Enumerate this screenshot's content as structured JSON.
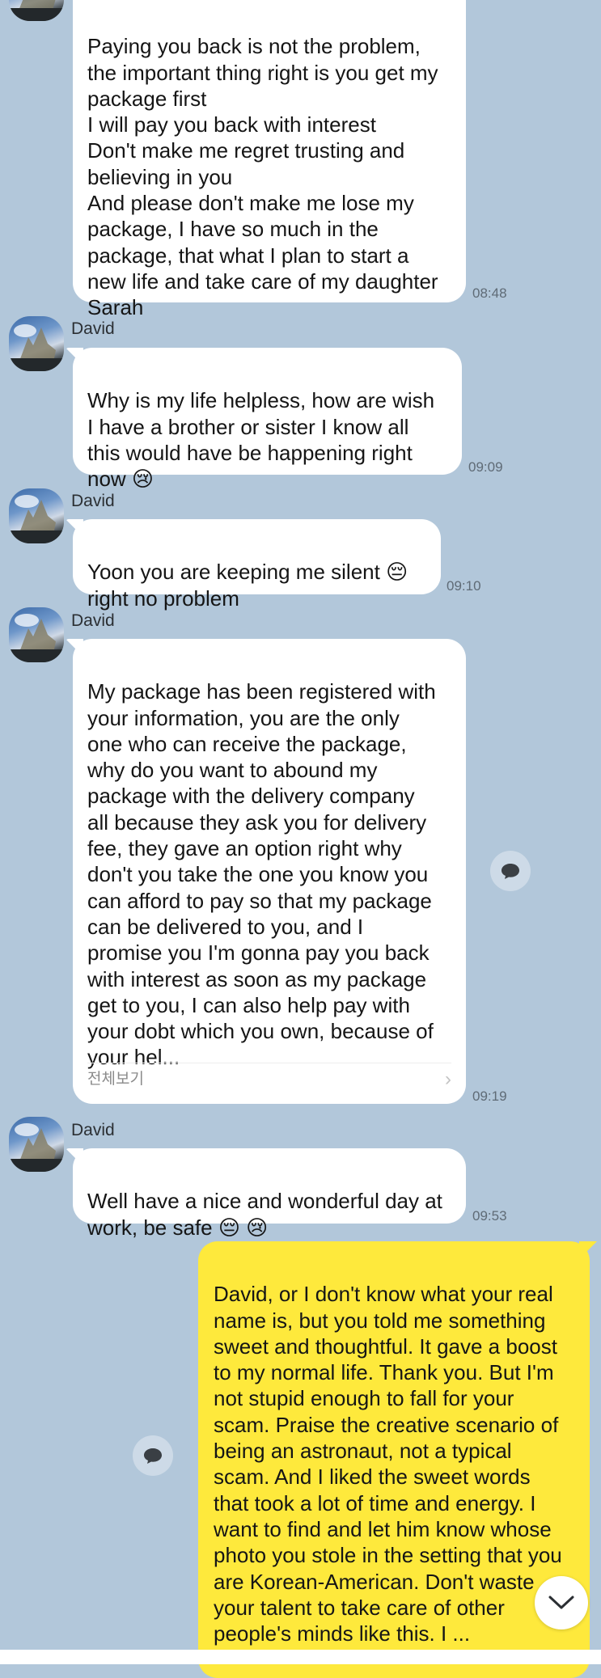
{
  "messages": [
    {
      "text": "Paying you back is not the problem,\nthe important thing right is you get my\npackage first\nI will pay you back with interest\nDon't make me regret trusting and\nbelieving in you\nAnd please don't make me lose my\npackage, I have so much in the\npackage, that what I plan to start a\nnew life and take care of my daughter\nSarah",
      "time": "08:48"
    },
    {
      "sender": "David",
      "text": "Why is my life helpless, how are wish\nI have a brother or sister I know all\nthis would have be happening right\nnow 😢",
      "time": "09:09"
    },
    {
      "sender": "David",
      "text": "Yoon you are keeping me silent 😔\nright no problem",
      "time": "09:10"
    },
    {
      "sender": "David",
      "text": "My package has been registered with\nyour information,  you are the only\none who can receive the package,\nwhy do you want to abound my\npackage with the delivery company\nall because they ask you for delivery\nfee,  they gave an option right why\ndon't you take the one you know you\ncan afford to pay so that my package\ncan be delivered to you, and I\npromise you I'm gonna pay you back\nwith interest as soon as my package\nget to you, I can also help pay with\nyour dobt which you own, because of\nyour hel...",
      "more_label": "전체보기",
      "time": "09:19"
    },
    {
      "sender": "David",
      "text": "Well have a nice and wonderful day at\nwork, be safe 😔 😢",
      "time": "09:53"
    },
    {
      "text": "David, or I don't know what your real\nname is, but you told me something\nsweet and thoughtful. It gave a boost\nto my normal life. Thank you. But I'm\nnot stupid enough to fall for your\nscam. Praise the creative scenario of\nbeing an astronaut, not a typical\nscam. And I liked the sweet words\nthat took a lot of time and energy. I\nwant to find and let him know whose\nphoto you stole in the setting that you\nare Korean-American. Don't waste\nyour talent to take care of other\npeople's minds like this. I ..."
    }
  ],
  "colors": {
    "background": "#b2c7da",
    "incoming_bubble": "#ffffff",
    "outgoing_bubble": "#fee93c"
  },
  "icons": [
    "avatar",
    "share-icon",
    "chevron-right-icon",
    "chevron-down-icon"
  ]
}
